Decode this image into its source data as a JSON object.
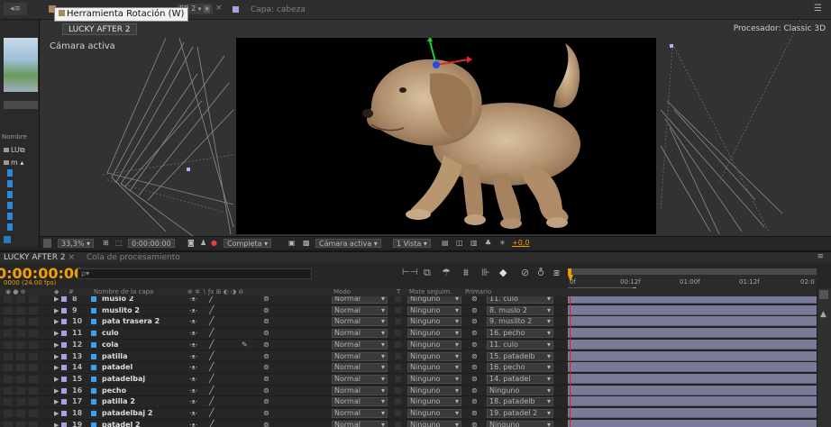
{
  "top": {
    "tooltip": "Herramienta Rotación (W)",
    "comp_dropdown": "ER 2",
    "layer_label": "Capa: cabeza",
    "comp_tab": "LUCKY AFTER 2",
    "processor": "Procesador:  Classic 3D",
    "menu_icon": "☰"
  },
  "left_panel": {
    "nombre_label": "Nombre",
    "item1": "LU",
    "item2": "m"
  },
  "viewer": {
    "camera_label": "Cámara activa",
    "toolbar": {
      "zoom": "33,3%",
      "timecode": "0:00:00:00",
      "resolution": "Completa",
      "camera": "Cámara activa",
      "view": "1 Vista",
      "exposure": "+0,0"
    }
  },
  "timeline": {
    "tabs": [
      "LUCKY AFTER 2",
      "Cola de procesamiento"
    ],
    "timecode": "0:00:00:00",
    "fps": "0000 (24.00 fps)",
    "search_placeholder": "ρ▾",
    "ruler_labels": [
      "0f",
      "00:12f",
      "01:00f",
      "01:12f",
      "02:0"
    ],
    "col_headers": {
      "num": "#",
      "name": "Nombre de la capa",
      "mode": "Modo",
      "t": "T",
      "mate": "Mate seguim.",
      "parent": "Primario"
    },
    "layers": [
      {
        "num": "8",
        "name": "muslo 2",
        "mode": "Normal",
        "mate": "Ninguno",
        "parent": "11. culo"
      },
      {
        "num": "9",
        "name": "muslito 2",
        "mode": "Normal",
        "mate": "Ninguno",
        "parent": "8. muslo 2"
      },
      {
        "num": "10",
        "name": "pata trasera 2",
        "mode": "Normal",
        "mate": "Ninguno",
        "parent": "9. muslito 2"
      },
      {
        "num": "11",
        "name": "culo",
        "mode": "Normal",
        "mate": "Ninguno",
        "parent": "16. pecho"
      },
      {
        "num": "12",
        "name": "cola",
        "mode": "Normal",
        "mate": "Ninguno",
        "parent": "11. culo"
      },
      {
        "num": "13",
        "name": "patilla",
        "mode": "Normal",
        "mate": "Ninguno",
        "parent": "15. patadelb"
      },
      {
        "num": "14",
        "name": "patadel",
        "mode": "Normal",
        "mate": "Ninguno",
        "parent": "16. pecho"
      },
      {
        "num": "15",
        "name": "patadelbaj",
        "mode": "Normal",
        "mate": "Ninguno",
        "parent": "14. patadel"
      },
      {
        "num": "16",
        "name": "pecho",
        "mode": "Normal",
        "mate": "Ninguno",
        "parent": "Ninguno"
      },
      {
        "num": "17",
        "name": "patilla 2",
        "mode": "Normal",
        "mate": "Ninguno",
        "parent": "18. patadelb"
      },
      {
        "num": "18",
        "name": "patadelbaj 2",
        "mode": "Normal",
        "mate": "Ninguno",
        "parent": "19. patadel 2"
      },
      {
        "num": "19",
        "name": "patadel 2",
        "mode": "Normal",
        "mate": "Ninguno",
        "parent": "Ninguno"
      }
    ]
  },
  "colors": {
    "accent_orange": "#e8a000",
    "timecode_orange": "#f0a000",
    "track_fill": "#7a7a99",
    "layer_label_blue": "#3aa0f0",
    "playhead_red": "#e02020"
  }
}
